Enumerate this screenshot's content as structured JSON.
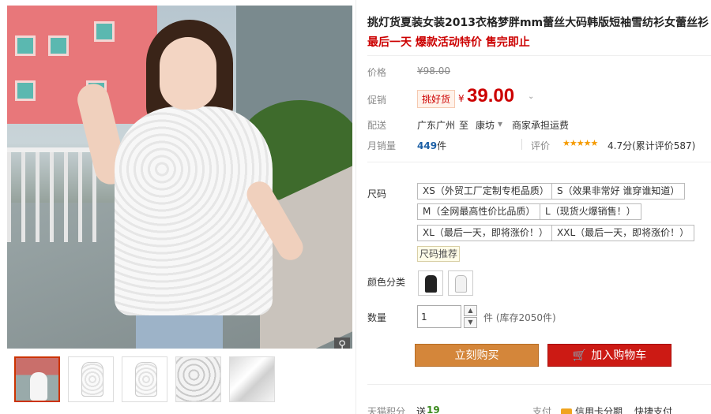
{
  "gallery": {
    "zoom_icon": "magnifier",
    "thumbnails": [
      "model-front",
      "shirt-front",
      "shirt-back",
      "lace-closeup",
      "fabric-closeup"
    ]
  },
  "product": {
    "title": "挑灯货夏装女装2013衣格梦胖mm蕾丝大码韩版短袖雪纺衫女蕾丝衫",
    "subtitle": "最后一天 爆款活动特价 售完即止"
  },
  "price": {
    "label": "价格",
    "original": "¥98.00",
    "promo_label": "促销",
    "promo_tag": "挑好货",
    "currency": "¥",
    "value": "39.00",
    "arrow": "⌄"
  },
  "shipping": {
    "label": "配送",
    "from": "广东广州",
    "to_word": "至",
    "to": "康坊",
    "dropdown": "▾",
    "note": "商家承担运费"
  },
  "sales": {
    "label": "月销量",
    "count": "449",
    "unit": "件",
    "review_label": "评价",
    "stars": "★★★★★",
    "rating": "4.7分(累计评价587)"
  },
  "sizes": {
    "label": "尺码",
    "options": [
      "XS（外贸工厂定制专柜品质）",
      "S（效果非常好 谁穿谁知道）",
      "M（全网最高性价比品质）",
      "L（现货火爆销售！）",
      "XL（最后一天，即将涨价！）",
      "XXL（最后一天，即将涨价！）"
    ],
    "chart_link": "尺码推荐"
  },
  "color": {
    "label": "颜色分类",
    "swatches": [
      "black",
      "white"
    ]
  },
  "quantity": {
    "label": "数量",
    "value": "1",
    "up": "▲",
    "down": "▼",
    "unit_stock": "件 (库存2050件)"
  },
  "buttons": {
    "buy_now": "立刻购买",
    "add_cart": "加入购物车",
    "cart_icon": "🛒"
  },
  "bottom": {
    "points_label": "天猫积分",
    "points_prefix": "送",
    "points_value": "19",
    "pay_label": "支付",
    "credit": "信用卡分期",
    "quick": "快捷支付"
  }
}
